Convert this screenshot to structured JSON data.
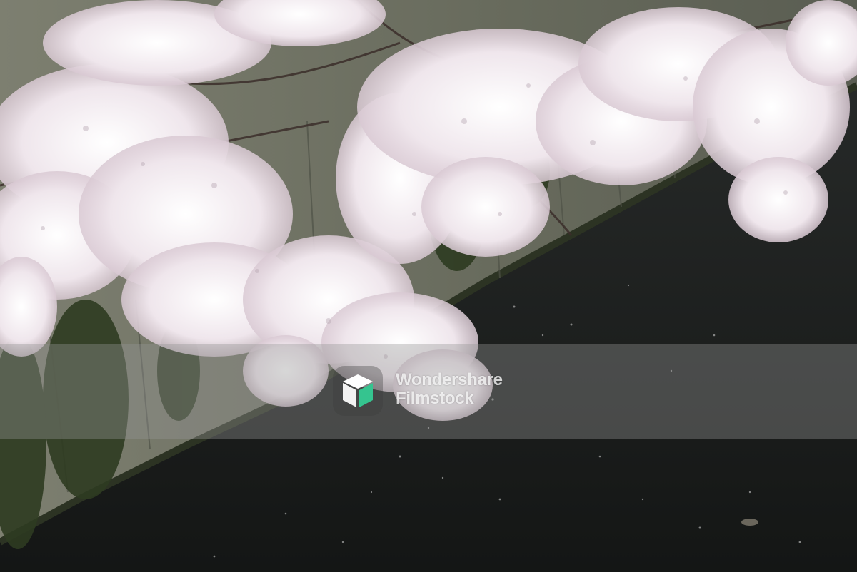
{
  "image": {
    "subject": "cherry-blossom-branches-over-canal",
    "colors": {
      "water": "#1f2221",
      "wall": "#6f7263",
      "blossom": "#f4eef3",
      "blossom_pink": "#e3cfd9",
      "ivy": "#2f3d22",
      "watermark_band": "#969696",
      "logo_accent": "#35c48f"
    }
  },
  "watermark": {
    "logo_icon": "wondershare-filmstock-cube-icon",
    "line1": "Wondershare",
    "line2": "Filmstock"
  }
}
